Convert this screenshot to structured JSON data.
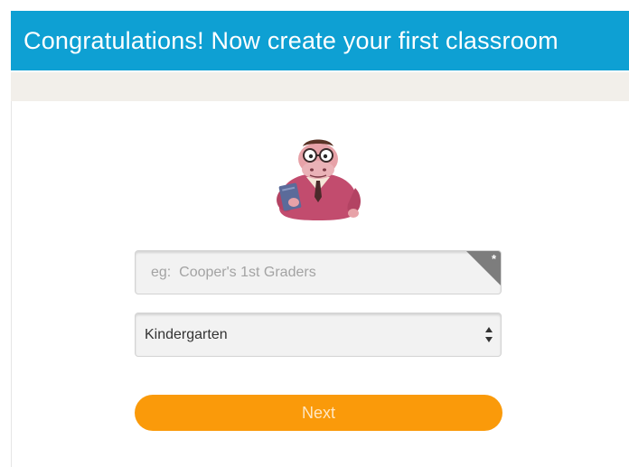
{
  "header": {
    "title": "Congratulations! Now create your first classroom"
  },
  "form": {
    "class_name": {
      "placeholder": "eg:  Cooper's 1st Graders",
      "value": "",
      "required_mark": "*"
    },
    "grade": {
      "selected": "Kindergarten"
    },
    "next_label": "Next"
  },
  "colors": {
    "header": "#0ea0d3",
    "sub_bar": "#f2efea",
    "button": "#fa9a0a",
    "button_text": "#ffe7c2",
    "required_corner": "#7d7d7d"
  },
  "icons": {
    "mascot": "teacher-mascot-icon",
    "required": "required-star-icon",
    "select": "select-arrows-icon"
  }
}
